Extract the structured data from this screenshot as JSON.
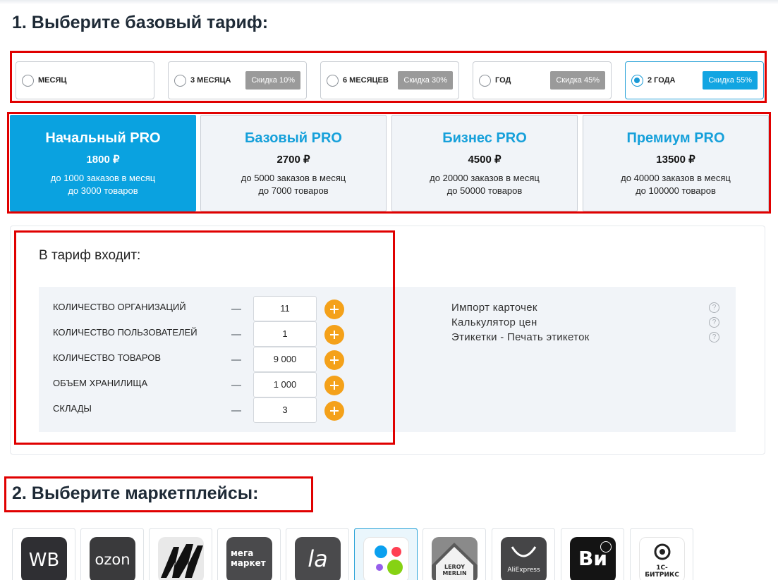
{
  "section1_title": "1. Выберите базовый тариф:",
  "section2_title": "2. Выберите маркетплейсы:",
  "periods": [
    {
      "label": "МЕСЯЦ",
      "discount": ""
    },
    {
      "label": "3 МЕСЯЦА",
      "discount": "Скидка 10%"
    },
    {
      "label": "6 МЕСЯЦЕВ",
      "discount": "Скидка 30%"
    },
    {
      "label": "ГОД",
      "discount": "Скидка 45%"
    },
    {
      "label": "2 ГОДА",
      "discount": "Скидка 55%"
    }
  ],
  "selected_period": "2 ГОДА",
  "plans": [
    {
      "name": "Начальный PRO",
      "price": "1800 ₽",
      "orders": "до 1000 заказов в месяц",
      "products": "до 3000 товаров"
    },
    {
      "name": "Базовый PRO",
      "price": "2700 ₽",
      "orders": "до 5000 заказов в месяц",
      "products": "до 7000 товаров"
    },
    {
      "name": "Бизнес PRO",
      "price": "4500 ₽",
      "orders": "до 20000 заказов в месяц",
      "products": "до 50000 товаров"
    },
    {
      "name": "Премиум PRO",
      "price": "13500 ₽",
      "orders": "до 40000 заказов в месяц",
      "products": "до 100000 товаров"
    }
  ],
  "selected_plan": "Начальный PRO",
  "includes": {
    "title": "В тариф входит:",
    "options": [
      {
        "label": "КОЛИЧЕСТВО ОРГАНИЗАЦИЙ",
        "value": "11"
      },
      {
        "label": "КОЛИЧЕСТВО ПОЛЬЗОВАТЕЛЕЙ",
        "value": "1"
      },
      {
        "label": "КОЛИЧЕСТВО ТОВАРОВ",
        "value": "9 000"
      },
      {
        "label": "ОБЪЕМ ХРАНИЛИЩА",
        "value": "1 000"
      },
      {
        "label": "СКЛАДЫ",
        "value": "3"
      }
    ],
    "features": [
      "Импорт карточек",
      "Калькулятор цен",
      "Этикетки - Печать этикеток"
    ],
    "help_glyph": "?"
  },
  "marketplaces": [
    {
      "logo_text": "WB",
      "icon": "wildberries-logo"
    },
    {
      "logo_text": "ozon",
      "icon": "ozon-logo"
    },
    {
      "logo_text": "",
      "icon": "yandex-market-logo"
    },
    {
      "logo_text": "мега маркет",
      "icon": "megamarket-logo"
    },
    {
      "logo_text": "la",
      "icon": "lamoda-logo"
    },
    {
      "logo_text": "",
      "icon": "avito-dots-logo"
    },
    {
      "logo_text": "LEROY MERLIN",
      "icon": "leroy-merlin-logo"
    },
    {
      "logo_text": "AliExpress",
      "icon": "aliexpress-logo"
    },
    {
      "logo_text": "Ви",
      "icon": "vseinstrumenti-logo"
    },
    {
      "logo_text": "1С-БИТРИКС",
      "icon": "bitrix-logo"
    }
  ],
  "selected_marketplace": "avito-dots-logo",
  "colors": {
    "accent": "#0aa2e0",
    "plus": "#f4a11a",
    "highlight": "#e00000"
  }
}
